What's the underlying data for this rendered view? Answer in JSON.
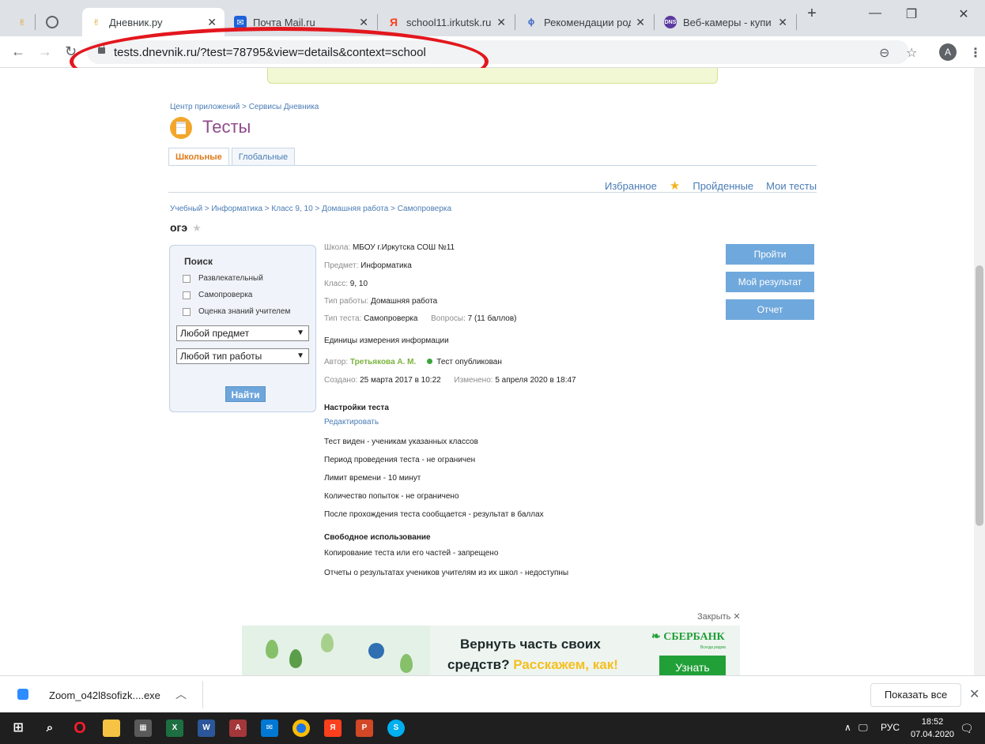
{
  "browser": {
    "tabs": [
      {
        "title": "",
        "active": false
      },
      {
        "title": "",
        "active": false
      },
      {
        "title": "Дневник.ру",
        "active": true
      },
      {
        "title": "Почта Mail.ru",
        "active": false
      },
      {
        "title": "school11.irkutsk.ru",
        "active": false
      },
      {
        "title": "Рекомендации род",
        "active": false
      },
      {
        "title": "Веб-камеры - купи",
        "active": false
      }
    ],
    "new_tab": "+",
    "minimize": "—",
    "restore": "❐",
    "close": "✕",
    "url": "tests.dnevnik.ru/?test=78795&view=details&context=school",
    "profile_letter": "A"
  },
  "page": {
    "breadcrumb_top": "Центр приложений > Сервисы Дневника",
    "title": "Тесты",
    "section_tabs": [
      "Школьные",
      "Глобальные"
    ],
    "links": {
      "favorites": "Избранное",
      "passed": "Пройденные",
      "my_tests": "Мои тесты"
    },
    "breadcrumb": "Учебный > Информатика > Класс 9, 10 > Домашняя работа > Самопроверка",
    "test_name": "огэ",
    "search": {
      "title": "Поиск",
      "checkboxes": [
        "Развлекательный",
        "Самопроверка",
        "Оценка знаний учителем"
      ],
      "subject_select": "Любой предмет",
      "worktype_select": "Любой тип работы",
      "find_button": "Найти"
    },
    "details": {
      "school_label": "Школа:",
      "school": "МБОУ г.Иркутска СОШ №11",
      "subject_label": "Предмет:",
      "subject": "Информатика",
      "class_label": "Класс:",
      "class": "9, 10",
      "worktype_label": "Тип работы:",
      "worktype": "Домашняя работа",
      "testtype_label": "Тип теста:",
      "testtype": "Самопроверка",
      "questions_label": "Вопросы:",
      "questions": "7 (11 баллов)",
      "description": "Единицы измерения информации",
      "author_label": "Автор:",
      "author": "Третьякова А. М.",
      "published": "Тест опубликован",
      "created_label": "Создано:",
      "created": "25 марта 2017 в 10:22",
      "modified_label": "Изменено:",
      "modified": "5 апреля 2020 в 18:47"
    },
    "settings": {
      "title": "Настройки теста",
      "edit": "Редактировать",
      "lines": [
        "Тест виден - ученикам указанных классов",
        "Период проведения теста - не ограничен",
        "Лимит времени - 10 минут",
        "Количество попыток - не ограничено",
        "После прохождения теста сообщается - результат в баллах"
      ]
    },
    "free_use": {
      "title": "Свободное использование",
      "lines": [
        "Копирование теста или его частей - запрещено",
        "Отчеты о результатах учеников учителям из их школ - недоступны"
      ]
    },
    "buttons": {
      "take": "Пройти",
      "my_result": "Мой результат",
      "report": "Отчет"
    },
    "ad": {
      "close": "Закрыть ✕",
      "line1": "Вернуть часть своих",
      "line2": "средств? ",
      "line2_highlight": "Расскажем, как!",
      "brand": "СБЕРБАНК",
      "brand_sub": "Всегда рядом",
      "cta": "Узнать"
    }
  },
  "downloads": {
    "file": "Zoom_o42l8sofizk....exe",
    "show_all": "Показать все"
  },
  "taskbar": {
    "lang": "РУС",
    "time": "18:52",
    "date": "07.04.2020"
  },
  "colors": {
    "annotation_red": "#e3171e",
    "link_blue": "#4a7cb5",
    "title_purple": "#8e4a8a",
    "button_blue": "#6fa8dc",
    "sber_green": "#21a038"
  }
}
